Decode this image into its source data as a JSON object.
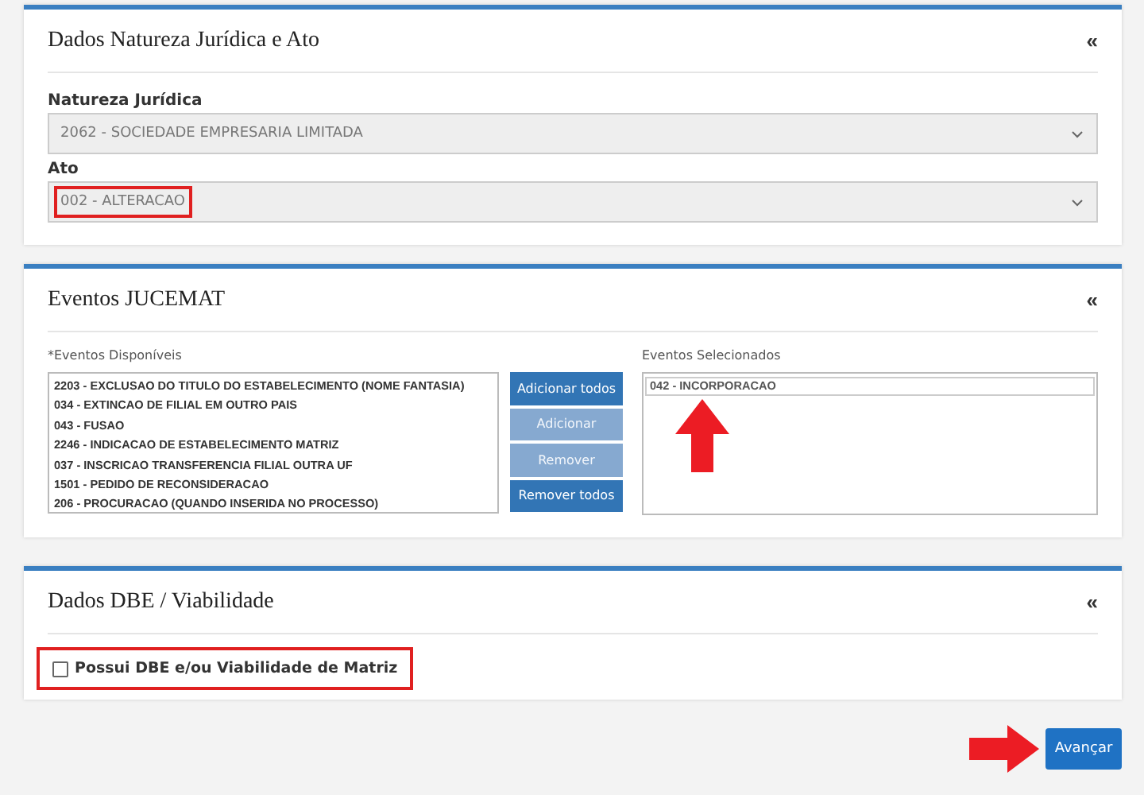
{
  "natureza_panel": {
    "title": "Dados Natureza Jurídica e Ato",
    "collapse": "«",
    "fields": [
      {
        "label": "Natureza Jurídica",
        "value": "2062 - SOCIEDADE EMPRESARIA LIMITADA",
        "highlighted": false
      },
      {
        "label": "Ato",
        "value": "002 - ALTERACAO",
        "highlighted": true
      }
    ]
  },
  "eventos_panel": {
    "title": "Eventos JUCEMAT",
    "collapse": "«",
    "available": {
      "label": "*Eventos Disponíveis",
      "items": [
        {
          "text": "2203 - EXCLUSAO DO TITULO DO ESTABELECIMENTO (NOME FANTASIA)",
          "selected": false
        },
        {
          "text": "034 - EXTINCAO DE FILIAL EM OUTRO PAIS",
          "selected": false
        },
        {
          "text": "043 - FUSAO",
          "selected": false
        },
        {
          "text": "2246 - INDICACAO DE ESTABELECIMENTO MATRIZ",
          "selected": false
        },
        {
          "text": "037 - INSCRICAO TRANSFERENCIA FILIAL OUTRA UF",
          "selected": false
        },
        {
          "text": "1501 - PEDIDO DE RECONSIDERACAO",
          "selected": false
        },
        {
          "text": "206 - PROCURACAO (QUANDO INSERIDA NO PROCESSO)",
          "selected": false
        }
      ]
    },
    "buttons": [
      {
        "label": "Adicionar todos",
        "disabled": false
      },
      {
        "label": "Adicionar",
        "disabled": true
      },
      {
        "label": "Remover",
        "disabled": true
      },
      {
        "label": "Remover todos",
        "disabled": false
      }
    ],
    "selected_list": {
      "label": "Eventos Selecionados",
      "items": [
        {
          "text": "042 - INCORPORACAO",
          "selected": true
        }
      ]
    }
  },
  "dbe_panel": {
    "title": "Dados DBE / Viabilidade",
    "collapse": "«",
    "checkbox": {
      "label": "Possui DBE e/ou Viabilidade de Matriz",
      "checked": false,
      "highlighted": true
    }
  },
  "next_button": {
    "label": "Avançar"
  }
}
